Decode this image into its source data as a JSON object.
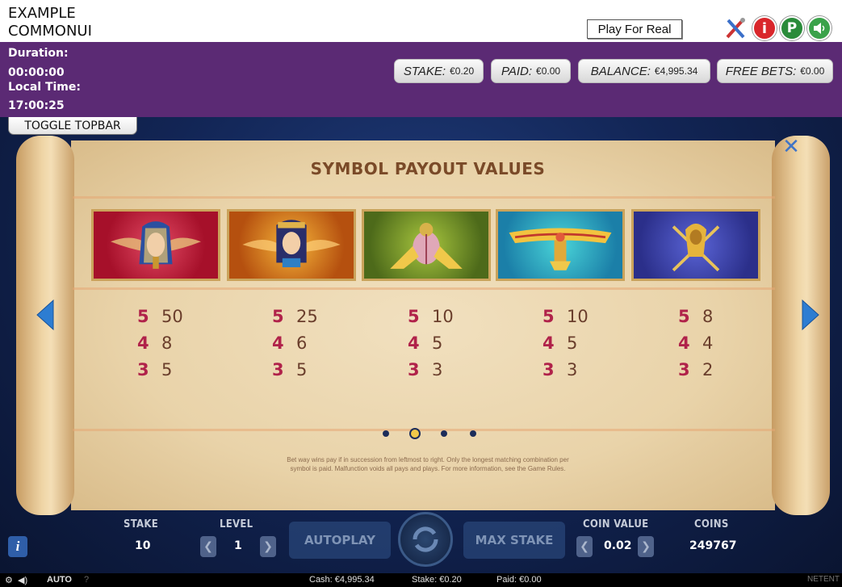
{
  "brand": {
    "line1": "EXAMPLE",
    "line2": "COMMONUI"
  },
  "topbar": {
    "duration_label": "Duration:",
    "duration_value": "00:00:00",
    "localtime_label": "Local Time:",
    "localtime_value": "17:00:25",
    "play_real": "Play For Real",
    "toggle": "TOGGLE TOPBAR",
    "stake_label": "STAKE:",
    "stake_value": "€0.20",
    "paid_label": "PAID:",
    "paid_value": "€0.00",
    "balance_label": "BALANCE:",
    "balance_value": "€4,995.34",
    "freebets_label": "FREE BETS:",
    "freebets_value": "€0.00",
    "icons": [
      "tools-icon",
      "info-icon",
      "p-icon",
      "sound-icon"
    ]
  },
  "paytable": {
    "title": "SYMBOL PAYOUT VALUES",
    "symbols": [
      {
        "name": "pharaoh",
        "pays": [
          [
            "5",
            "50"
          ],
          [
            "4",
            "8"
          ],
          [
            "3",
            "5"
          ]
        ]
      },
      {
        "name": "cleopatra",
        "pays": [
          [
            "5",
            "25"
          ],
          [
            "4",
            "6"
          ],
          [
            "3",
            "5"
          ]
        ]
      },
      {
        "name": "scarab",
        "pays": [
          [
            "5",
            "10"
          ],
          [
            "4",
            "5"
          ],
          [
            "3",
            "3"
          ]
        ]
      },
      {
        "name": "winged-sun",
        "pays": [
          [
            "5",
            "10"
          ],
          [
            "4",
            "5"
          ],
          [
            "3",
            "3"
          ]
        ]
      },
      {
        "name": "cobra",
        "pays": [
          [
            "5",
            "8"
          ],
          [
            "4",
            "4"
          ],
          [
            "3",
            "2"
          ]
        ]
      }
    ],
    "page_current": 2,
    "page_count": 4,
    "fine_print_1": "Bet way wins pay if in succession from leftmost to right. Only the longest matching combination per",
    "fine_print_2": "symbol is paid. Malfunction voids all pays and plays. For more information, see the Game Rules."
  },
  "controls": {
    "stake_label": "STAKE",
    "stake_value": "10",
    "level_label": "LEVEL",
    "level_value": "1",
    "autoplay": "AUTOPLAY",
    "max_stake": "MAX STAKE",
    "coin_value_label": "COIN VALUE",
    "coin_value": "0.02",
    "coins_label": "COINS",
    "coins_value": "249767"
  },
  "statusbar": {
    "auto": "AUTO",
    "help": "?",
    "cash": "Cash: €4,995.34",
    "stake": "Stake: €0.20",
    "paid": "Paid: €0.00",
    "provider": "NETENT"
  },
  "colors": {
    "topbar": "#5b2a74",
    "payout_count": "#b0224a",
    "title": "#7a4a28"
  }
}
